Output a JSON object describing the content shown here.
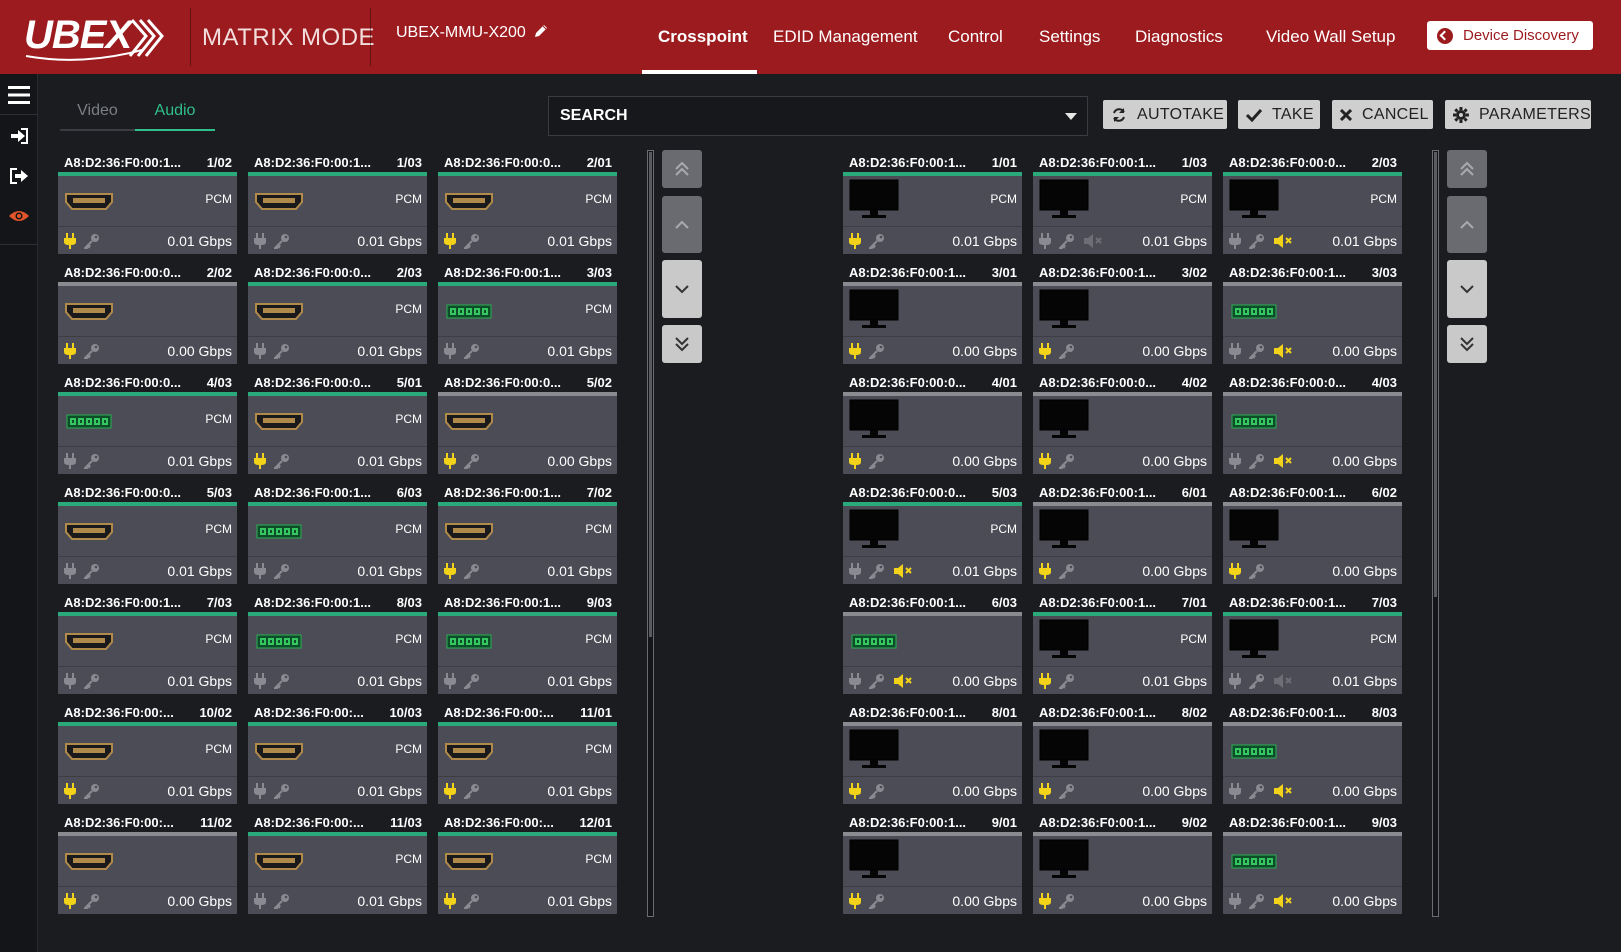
{
  "header": {
    "brand": "UBEX",
    "mode": "MATRIX MODE",
    "device_name": "UBEX-MMU-X200",
    "nav": [
      {
        "label": "Crosspoint",
        "active": true
      },
      {
        "label": "EDID Management",
        "active": false
      },
      {
        "label": "Control",
        "active": false
      },
      {
        "label": "Settings",
        "active": false
      },
      {
        "label": "Diagnostics",
        "active": false
      },
      {
        "label": "Video Wall Setup",
        "active": false
      }
    ],
    "device_discovery": "Device Discovery"
  },
  "sidebar": {
    "items": [
      {
        "icon": "menu-icon"
      },
      {
        "icon": "login-icon"
      },
      {
        "icon": "logout-icon"
      },
      {
        "icon": "eye-icon"
      }
    ]
  },
  "tabs": [
    {
      "label": "Video",
      "active": false
    },
    {
      "label": "Audio",
      "active": true
    }
  ],
  "search": {
    "placeholder": "SEARCH"
  },
  "actions": {
    "autotake": "AUTOTAKE",
    "take": "TAKE",
    "cancel": "CANCEL",
    "parameters": "PARAMETERS"
  },
  "colors": {
    "header_red": "#9c1b1f",
    "accent_green": "#2aaa7a",
    "plug_yellow": "#f2d31a",
    "tile_gray": "#4b4c55"
  },
  "sources": [
    {
      "mac": "A8:D2:36:F0:00:1...",
      "port": "1/02",
      "icon": "hdmi",
      "pcm": true,
      "plug": true,
      "rate": "0.01 Gbps",
      "bar": "green"
    },
    {
      "mac": "A8:D2:36:F0:00:1...",
      "port": "1/03",
      "icon": "hdmi",
      "pcm": true,
      "plug": false,
      "rate": "0.01 Gbps",
      "bar": "green"
    },
    {
      "mac": "A8:D2:36:F0:00:0...",
      "port": "2/01",
      "icon": "hdmi",
      "pcm": true,
      "plug": true,
      "rate": "0.01 Gbps",
      "bar": "green"
    },
    {
      "mac": "A8:D2:36:F0:00:0...",
      "port": "2/02",
      "icon": "hdmi",
      "pcm": false,
      "plug": true,
      "rate": "0.00 Gbps",
      "bar": "gray"
    },
    {
      "mac": "A8:D2:36:F0:00:0...",
      "port": "2/03",
      "icon": "hdmi",
      "pcm": true,
      "plug": false,
      "rate": "0.01 Gbps",
      "bar": "green"
    },
    {
      "mac": "A8:D2:36:F0:00:1...",
      "port": "3/03",
      "icon": "terminal",
      "pcm": true,
      "plug": false,
      "rate": "0.01 Gbps",
      "bar": "green"
    },
    {
      "mac": "A8:D2:36:F0:00:0...",
      "port": "4/03",
      "icon": "terminal",
      "pcm": true,
      "plug": false,
      "rate": "0.01 Gbps",
      "bar": "green"
    },
    {
      "mac": "A8:D2:36:F0:00:0...",
      "port": "5/01",
      "icon": "hdmi",
      "pcm": true,
      "plug": true,
      "rate": "0.01 Gbps",
      "bar": "green"
    },
    {
      "mac": "A8:D2:36:F0:00:0...",
      "port": "5/02",
      "icon": "hdmi",
      "pcm": false,
      "plug": true,
      "rate": "0.00 Gbps",
      "bar": "gray"
    },
    {
      "mac": "A8:D2:36:F0:00:0...",
      "port": "5/03",
      "icon": "hdmi",
      "pcm": true,
      "plug": false,
      "rate": "0.01 Gbps",
      "bar": "green"
    },
    {
      "mac": "A8:D2:36:F0:00:1...",
      "port": "6/03",
      "icon": "terminal",
      "pcm": true,
      "plug": false,
      "rate": "0.01 Gbps",
      "bar": "green"
    },
    {
      "mac": "A8:D2:36:F0:00:1...",
      "port": "7/02",
      "icon": "hdmi",
      "pcm": true,
      "plug": true,
      "rate": "0.01 Gbps",
      "bar": "green"
    },
    {
      "mac": "A8:D2:36:F0:00:1...",
      "port": "7/03",
      "icon": "hdmi",
      "pcm": true,
      "plug": false,
      "rate": "0.01 Gbps",
      "bar": "green"
    },
    {
      "mac": "A8:D2:36:F0:00:1...",
      "port": "8/03",
      "icon": "terminal",
      "pcm": true,
      "plug": false,
      "rate": "0.01 Gbps",
      "bar": "green"
    },
    {
      "mac": "A8:D2:36:F0:00:1...",
      "port": "9/03",
      "icon": "terminal",
      "pcm": true,
      "plug": false,
      "rate": "0.01 Gbps",
      "bar": "green"
    },
    {
      "mac": "A8:D2:36:F0:00:...",
      "port": "10/02",
      "icon": "hdmi",
      "pcm": true,
      "plug": true,
      "rate": "0.01 Gbps",
      "bar": "green"
    },
    {
      "mac": "A8:D2:36:F0:00:...",
      "port": "10/03",
      "icon": "hdmi",
      "pcm": true,
      "plug": false,
      "rate": "0.01 Gbps",
      "bar": "green"
    },
    {
      "mac": "A8:D2:36:F0:00:...",
      "port": "11/01",
      "icon": "hdmi",
      "pcm": true,
      "plug": true,
      "rate": "0.01 Gbps",
      "bar": "green"
    },
    {
      "mac": "A8:D2:36:F0:00:...",
      "port": "11/02",
      "icon": "hdmi",
      "pcm": false,
      "plug": true,
      "rate": "0.00 Gbps",
      "bar": "gray"
    },
    {
      "mac": "A8:D2:36:F0:00:...",
      "port": "11/03",
      "icon": "hdmi",
      "pcm": true,
      "plug": false,
      "rate": "0.01 Gbps",
      "bar": "green"
    },
    {
      "mac": "A8:D2:36:F0:00:...",
      "port": "12/01",
      "icon": "hdmi",
      "pcm": true,
      "plug": true,
      "rate": "0.01 Gbps",
      "bar": "green"
    }
  ],
  "destinations": [
    {
      "mac": "A8:D2:36:F0:00:1...",
      "port": "1/01",
      "icon": "monitor",
      "pcm": true,
      "plug": true,
      "mute": false,
      "rate": "0.01 Gbps",
      "bar": "green"
    },
    {
      "mac": "A8:D2:36:F0:00:1...",
      "port": "1/03",
      "icon": "monitor",
      "pcm": true,
      "plug": false,
      "mute": "dim",
      "rate": "0.01 Gbps",
      "bar": "green"
    },
    {
      "mac": "A8:D2:36:F0:00:0...",
      "port": "2/03",
      "icon": "monitor",
      "pcm": true,
      "plug": false,
      "mute": "on",
      "rate": "0.01 Gbps",
      "bar": "green"
    },
    {
      "mac": "A8:D2:36:F0:00:1...",
      "port": "3/01",
      "icon": "monitor",
      "pcm": false,
      "plug": true,
      "mute": false,
      "rate": "0.00 Gbps",
      "bar": "gray"
    },
    {
      "mac": "A8:D2:36:F0:00:1...",
      "port": "3/02",
      "icon": "monitor",
      "pcm": false,
      "plug": true,
      "mute": false,
      "rate": "0.00 Gbps",
      "bar": "gray"
    },
    {
      "mac": "A8:D2:36:F0:00:1...",
      "port": "3/03",
      "icon": "terminal",
      "pcm": false,
      "plug": false,
      "mute": "on",
      "rate": "0.00 Gbps",
      "bar": "gray"
    },
    {
      "mac": "A8:D2:36:F0:00:0...",
      "port": "4/01",
      "icon": "monitor",
      "pcm": false,
      "plug": true,
      "mute": false,
      "rate": "0.00 Gbps",
      "bar": "gray"
    },
    {
      "mac": "A8:D2:36:F0:00:0...",
      "port": "4/02",
      "icon": "monitor",
      "pcm": false,
      "plug": true,
      "mute": false,
      "rate": "0.00 Gbps",
      "bar": "gray"
    },
    {
      "mac": "A8:D2:36:F0:00:0...",
      "port": "4/03",
      "icon": "terminal",
      "pcm": false,
      "plug": false,
      "mute": "on",
      "rate": "0.00 Gbps",
      "bar": "gray"
    },
    {
      "mac": "A8:D2:36:F0:00:0...",
      "port": "5/03",
      "icon": "monitor",
      "pcm": true,
      "plug": false,
      "mute": "on",
      "rate": "0.01 Gbps",
      "bar": "green"
    },
    {
      "mac": "A8:D2:36:F0:00:1...",
      "port": "6/01",
      "icon": "monitor",
      "pcm": false,
      "plug": true,
      "mute": false,
      "rate": "0.00 Gbps",
      "bar": "gray"
    },
    {
      "mac": "A8:D2:36:F0:00:1...",
      "port": "6/02",
      "icon": "monitor",
      "pcm": false,
      "plug": true,
      "mute": false,
      "rate": "0.00 Gbps",
      "bar": "gray"
    },
    {
      "mac": "A8:D2:36:F0:00:1...",
      "port": "6/03",
      "icon": "terminal",
      "pcm": false,
      "plug": false,
      "mute": "on",
      "rate": "0.00 Gbps",
      "bar": "gray"
    },
    {
      "mac": "A8:D2:36:F0:00:1...",
      "port": "7/01",
      "icon": "monitor",
      "pcm": true,
      "plug": true,
      "mute": false,
      "rate": "0.01 Gbps",
      "bar": "green"
    },
    {
      "mac": "A8:D2:36:F0:00:1...",
      "port": "7/03",
      "icon": "monitor",
      "pcm": true,
      "plug": false,
      "mute": "dim",
      "rate": "0.01 Gbps",
      "bar": "green"
    },
    {
      "mac": "A8:D2:36:F0:00:1...",
      "port": "8/01",
      "icon": "monitor",
      "pcm": false,
      "plug": true,
      "mute": false,
      "rate": "0.00 Gbps",
      "bar": "gray"
    },
    {
      "mac": "A8:D2:36:F0:00:1...",
      "port": "8/02",
      "icon": "monitor",
      "pcm": false,
      "plug": true,
      "mute": false,
      "rate": "0.00 Gbps",
      "bar": "gray"
    },
    {
      "mac": "A8:D2:36:F0:00:1...",
      "port": "8/03",
      "icon": "terminal",
      "pcm": false,
      "plug": false,
      "mute": "on",
      "rate": "0.00 Gbps",
      "bar": "gray"
    },
    {
      "mac": "A8:D2:36:F0:00:1...",
      "port": "9/01",
      "icon": "monitor",
      "pcm": false,
      "plug": true,
      "mute": false,
      "rate": "0.00 Gbps",
      "bar": "gray"
    },
    {
      "mac": "A8:D2:36:F0:00:1...",
      "port": "9/02",
      "icon": "monitor",
      "pcm": false,
      "plug": true,
      "mute": false,
      "rate": "0.00 Gbps",
      "bar": "gray"
    },
    {
      "mac": "A8:D2:36:F0:00:1...",
      "port": "9/03",
      "icon": "terminal",
      "pcm": false,
      "plug": false,
      "mute": "on",
      "rate": "0.00 Gbps",
      "bar": "gray"
    }
  ],
  "pcm_label": "PCM"
}
